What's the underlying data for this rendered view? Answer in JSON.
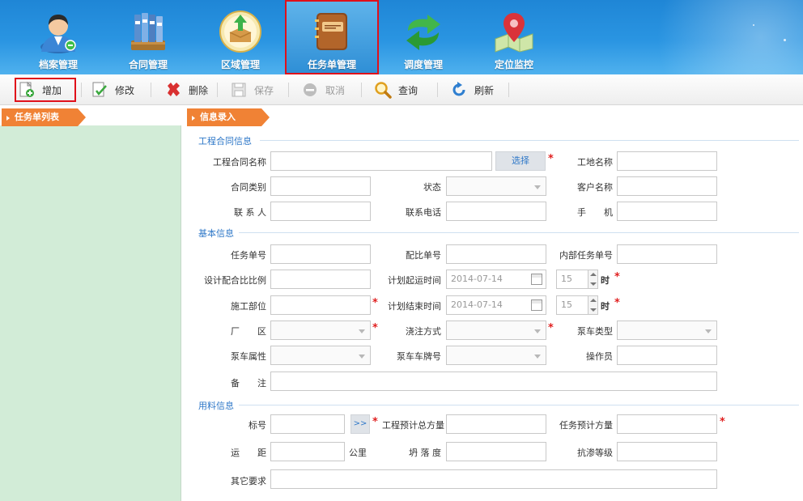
{
  "nav": {
    "items": [
      {
        "label": "档案管理",
        "icon": "user-avatar-icon"
      },
      {
        "label": "合同管理",
        "icon": "binders-icon"
      },
      {
        "label": "区域管理",
        "icon": "upload-box-icon"
      },
      {
        "label": "任务单管理",
        "icon": "notebook-icon",
        "active": true
      },
      {
        "label": "调度管理",
        "icon": "green-arrow-icon"
      },
      {
        "label": "定位监控",
        "icon": "map-pin-icon"
      }
    ]
  },
  "toolbar": {
    "add": "增加",
    "edit": "修改",
    "delete": "删除",
    "save": "保存",
    "cancel": "取消",
    "query": "查询",
    "refresh": "刷新"
  },
  "left_panel": {
    "title": "任务单列表"
  },
  "form": {
    "title": "信息录入",
    "sections": {
      "contract": "工程合同信息",
      "basic": "基本信息",
      "material": "用料信息"
    },
    "labels": {
      "project_contract_name": "工程合同名称",
      "choose": "选择",
      "site_name": "工地名称",
      "contract_type": "合同类别",
      "status": "状态",
      "customer_name": "客户名称",
      "contact": "联 系 人",
      "contact_phone": "联系电话",
      "mobile": "手　　机",
      "task_no": "任务单号",
      "mix_no": "配比单号",
      "internal_task_no": "内部任务单号",
      "design_mix_ratio": "设计配合比比例",
      "plan_start_time": "计划起运时间",
      "construction_part": "施工部位",
      "plan_end_time": "计划结束时间",
      "plant_area": "厂　　区",
      "pour_method": "浇注方式",
      "pump_type": "泵车类型",
      "pump_attr": "泵车属性",
      "pump_plate": "泵车车牌号",
      "operator": "操作员",
      "remark": "备　　注",
      "grade": "标号",
      "grade_btn": ">>",
      "total_volume": "工程预计总方量",
      "task_volume": "任务预计方量",
      "distance": "运　　距",
      "km_unit": "公里",
      "slump": "坍 落 度",
      "impermeability": "抗渗等级",
      "other_req": "其它要求",
      "hour_unit": "时"
    },
    "values": {
      "plan_start_date": "2014-07-14",
      "plan_start_hour": "15",
      "plan_end_date": "2014-07-14",
      "plan_end_hour": "15"
    }
  }
}
